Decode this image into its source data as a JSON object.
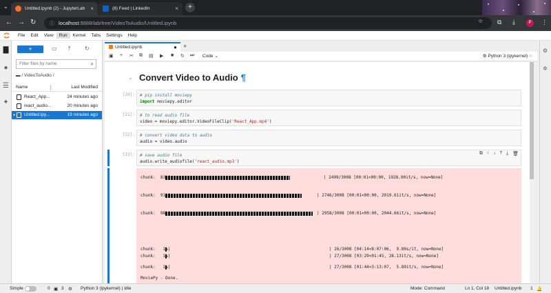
{
  "browser": {
    "tabs": [
      {
        "title": "Untitled.ipynb (2) - JupyterLab",
        "active": true
      },
      {
        "title": "(8) Feed | LinkedIn",
        "active": false
      }
    ],
    "url_host": "localhost",
    "url_path": ":8888/lab/tree/VideoToAudio/Untitled.ipynb",
    "profile_initial": "P"
  },
  "menu": [
    "File",
    "Edit",
    "View",
    "Run",
    "Kernel",
    "Tabs",
    "Settings",
    "Help"
  ],
  "menu_active": "Run",
  "filebrowser": {
    "new_label": "+",
    "search_placeholder": "Filter files by name",
    "breadcrumb": "/ VideoToAudio /",
    "col_name": "Name",
    "col_modified": "Last Modified",
    "files": [
      {
        "name": "React_App...",
        "modified": "24 minutes ago",
        "selected": false
      },
      {
        "name": "react_audio...",
        "modified": "20 minutes ago",
        "selected": false
      },
      {
        "name": "Untitled.ipy...",
        "modified": "19 minutes ago",
        "selected": true
      }
    ]
  },
  "notebook": {
    "tab_title": "Untitled.ipynb",
    "cell_type": "Code",
    "kernel_name": "Python 3 (ipykernel)",
    "heading": "Convert Video to Audio",
    "heading_anchor": "¶",
    "cells": [
      {
        "prompt": "[20]:",
        "lines": [
          {
            "kind": "comment",
            "text": "# pip install moviepy"
          },
          {
            "kind": "import",
            "kw": "import",
            "rest": " moviepy.editor"
          }
        ]
      },
      {
        "prompt": "[21]:",
        "lines": [
          {
            "kind": "comment",
            "text": "# to read audio file"
          },
          {
            "kind": "code",
            "pre": "video = moviepy.editor.VideoFileClip(",
            "str": "'React_App.mp4'",
            "post": ")"
          }
        ]
      },
      {
        "prompt": "[22]:",
        "lines": [
          {
            "kind": "comment",
            "text": "# convert video data to audio"
          },
          {
            "kind": "code",
            "pre": "audio = video.audio",
            "str": "",
            "post": ""
          }
        ]
      },
      {
        "prompt": "[23]:",
        "lines": [
          {
            "kind": "comment",
            "text": "# save audio file"
          },
          {
            "kind": "code",
            "pre": "audio.write_audiofile(",
            "str": "'react_audio.mp3'",
            "post": ")"
          }
        ]
      }
    ],
    "output": [
      {
        "label": "chunk:  83%|",
        "fill": 0.83,
        "stats": "| 2499/3008 [00:01<00:00, 1928.00it/s, now=None]"
      },
      {
        "label": "chunk:  91%|",
        "fill": 0.91,
        "stats": "| 2746/3008 [00:01<00:00, 2019.61it/s, now=None]"
      },
      {
        "label": "chunk:  98%|",
        "fill": 0.98,
        "stats": "| 2958/3008 [00:01<00:00, 2044.66it/s, now=None]"
      },
      {
        "label": "chunk:   1%|",
        "fill": 0.01,
        "stats": "| 26/3008 [04:14<8:07:06,  9.80s/it, now=None]"
      },
      {
        "label": "chunk:   1%|",
        "fill": 0.01,
        "stats": "| 27/3008 [03:29<01:45, 28.13it/s, now=None]"
      },
      {
        "label": "chunk:   1%|",
        "fill": 0.01,
        "stats": "| 27/3008 [01:44<3:13:07,  5.89it/s, now=None]"
      }
    ],
    "output_footer": "MoviePy - Done."
  },
  "status": {
    "mode_label": "Simple",
    "count_a": "0",
    "count_b": "3",
    "kernel": "Python 3 (ipykernel) | Idle",
    "mode": "Mode: Command",
    "position": "Ln 1, Col 18",
    "filename": "Untitled.ipynb",
    "bell_count": "1"
  },
  "colors": {
    "accent": "#1976d2",
    "stderr_bg": "#ffdddd",
    "chrome_dark": "#202124"
  }
}
